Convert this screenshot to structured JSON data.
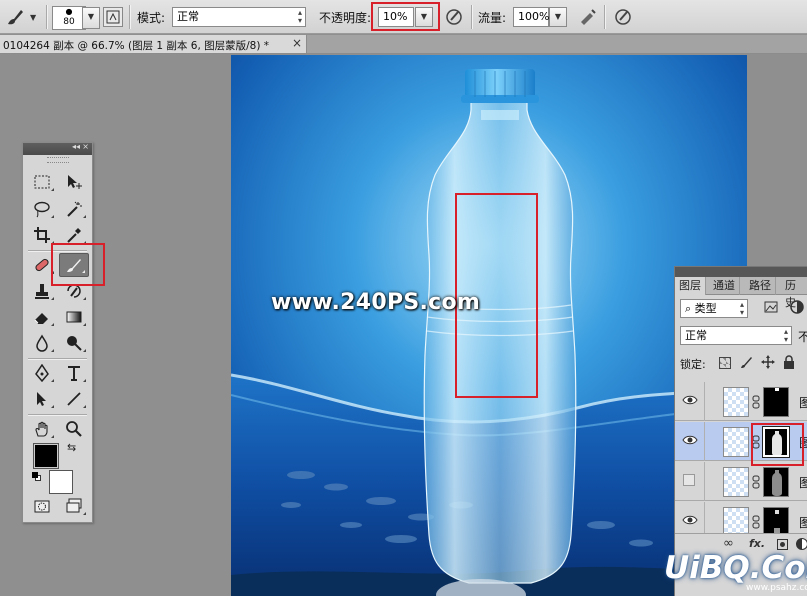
{
  "options_bar": {
    "brush_icon": "brush-icon",
    "brush_size": "80",
    "mode_label": "模式:",
    "mode_value": "正常",
    "opacity_label": "不透明度:",
    "opacity_value": "10%",
    "flow_label": "流量:",
    "flow_value": "100%"
  },
  "document_tab": {
    "title": "0104264 副本 @ 66.7% (图层 1 副本 6, 图层蒙版/8) *",
    "close": "×"
  },
  "canvas": {
    "watermark": "www.240PS.com",
    "corner_logo": "UiBQ.CoM",
    "corner_logo_sub": "www.psahz.com"
  },
  "tools_panel": {
    "collapse": "◂◂",
    "close": "×",
    "active_tool": "brush-tool"
  },
  "layers_panel": {
    "tabs": [
      "图层",
      "通道",
      "路径",
      "历史"
    ],
    "filter_label": "类型",
    "blend_mode": "正常",
    "opacity_label_partial": "不",
    "lock_label": "锁定:",
    "layers": [
      {
        "name": "图",
        "visible": true,
        "mask": "bottle-top"
      },
      {
        "name": "图",
        "visible": true,
        "mask": "bottle-full",
        "selected": true
      },
      {
        "name": "图",
        "visible": false,
        "mask": "bottle-gray"
      },
      {
        "name": "图",
        "visible": true,
        "mask": "bottle-partial"
      }
    ],
    "footer": {
      "link": "∞",
      "fx": "fx."
    }
  },
  "colors": {
    "highlight_red": "#d7202a",
    "foreground": "#000000",
    "background": "#ffffff",
    "selected_layer": "#bacbf0"
  }
}
